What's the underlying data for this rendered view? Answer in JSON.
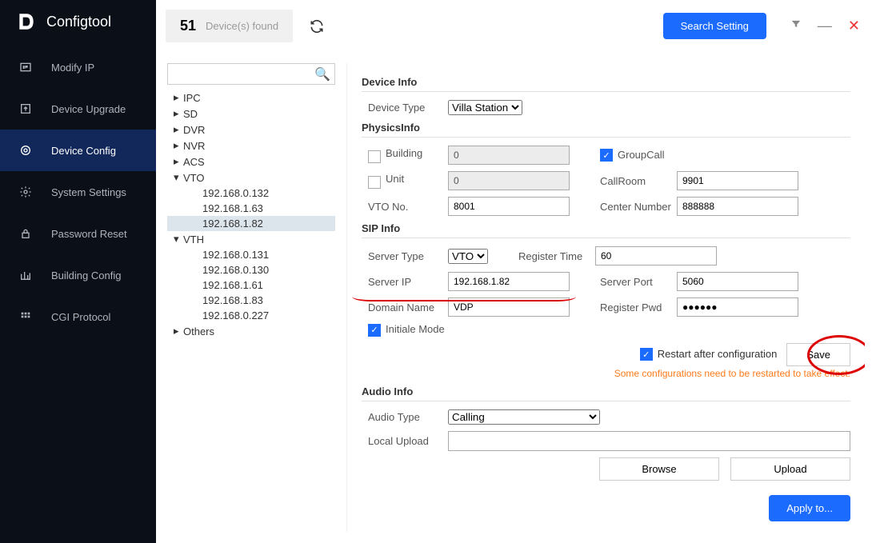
{
  "brand": "Configtool",
  "nav": [
    {
      "label": "Modify IP"
    },
    {
      "label": "Device Upgrade"
    },
    {
      "label": "Device Config"
    },
    {
      "label": "System Settings"
    },
    {
      "label": "Password Reset"
    },
    {
      "label": "Building Config"
    },
    {
      "label": "CGI Protocol"
    }
  ],
  "topbar": {
    "count": "51",
    "found_label": "Device(s) found",
    "search_setting": "Search Setting"
  },
  "tree": {
    "nodes": [
      "IPC",
      "SD",
      "DVR",
      "NVR",
      "ACS",
      "VTO",
      "VTH",
      "Others"
    ],
    "vto_children": [
      "192.168.0.132",
      "192.168.1.63",
      "192.168.1.82"
    ],
    "vth_children": [
      "192.168.0.131",
      "192.168.0.130",
      "192.168.1.61",
      "192.168.1.83",
      "192.168.0.227"
    ]
  },
  "device_info": {
    "section": "Device Info",
    "type_label": "Device Type",
    "type_value": "Villa Station"
  },
  "physics": {
    "section": "PhysicsInfo",
    "building_label": "Building",
    "building_value": "0",
    "unit_label": "Unit",
    "unit_value": "0",
    "vto_no_label": "VTO No.",
    "vto_no_value": "8001",
    "groupcall_label": "GroupCall",
    "callroom_label": "CallRoom",
    "callroom_value": "9901",
    "center_label": "Center Number",
    "center_value": "888888"
  },
  "sip": {
    "section": "SIP Info",
    "server_type_label": "Server Type",
    "server_type_value": "VTO",
    "server_ip_label": "Server IP",
    "server_ip_value": "192.168.1.82",
    "domain_label": "Domain Name",
    "domain_value": "VDP",
    "initiale_label": "Initiale Mode",
    "reg_time_label": "Register Time",
    "reg_time_value": "60",
    "server_port_label": "Server Port",
    "server_port_value": "5060",
    "reg_pwd_label": "Register Pwd",
    "reg_pwd_value": "●●●●●●",
    "restart_label": "Restart after configuration",
    "save_label": "Save",
    "notice": "Some configurations need to be restarted to take effect."
  },
  "audio": {
    "section": "Audio Info",
    "type_label": "Audio Type",
    "type_value": "Calling",
    "upload_label": "Local Upload",
    "browse": "Browse",
    "upload": "Upload"
  },
  "apply": "Apply to..."
}
